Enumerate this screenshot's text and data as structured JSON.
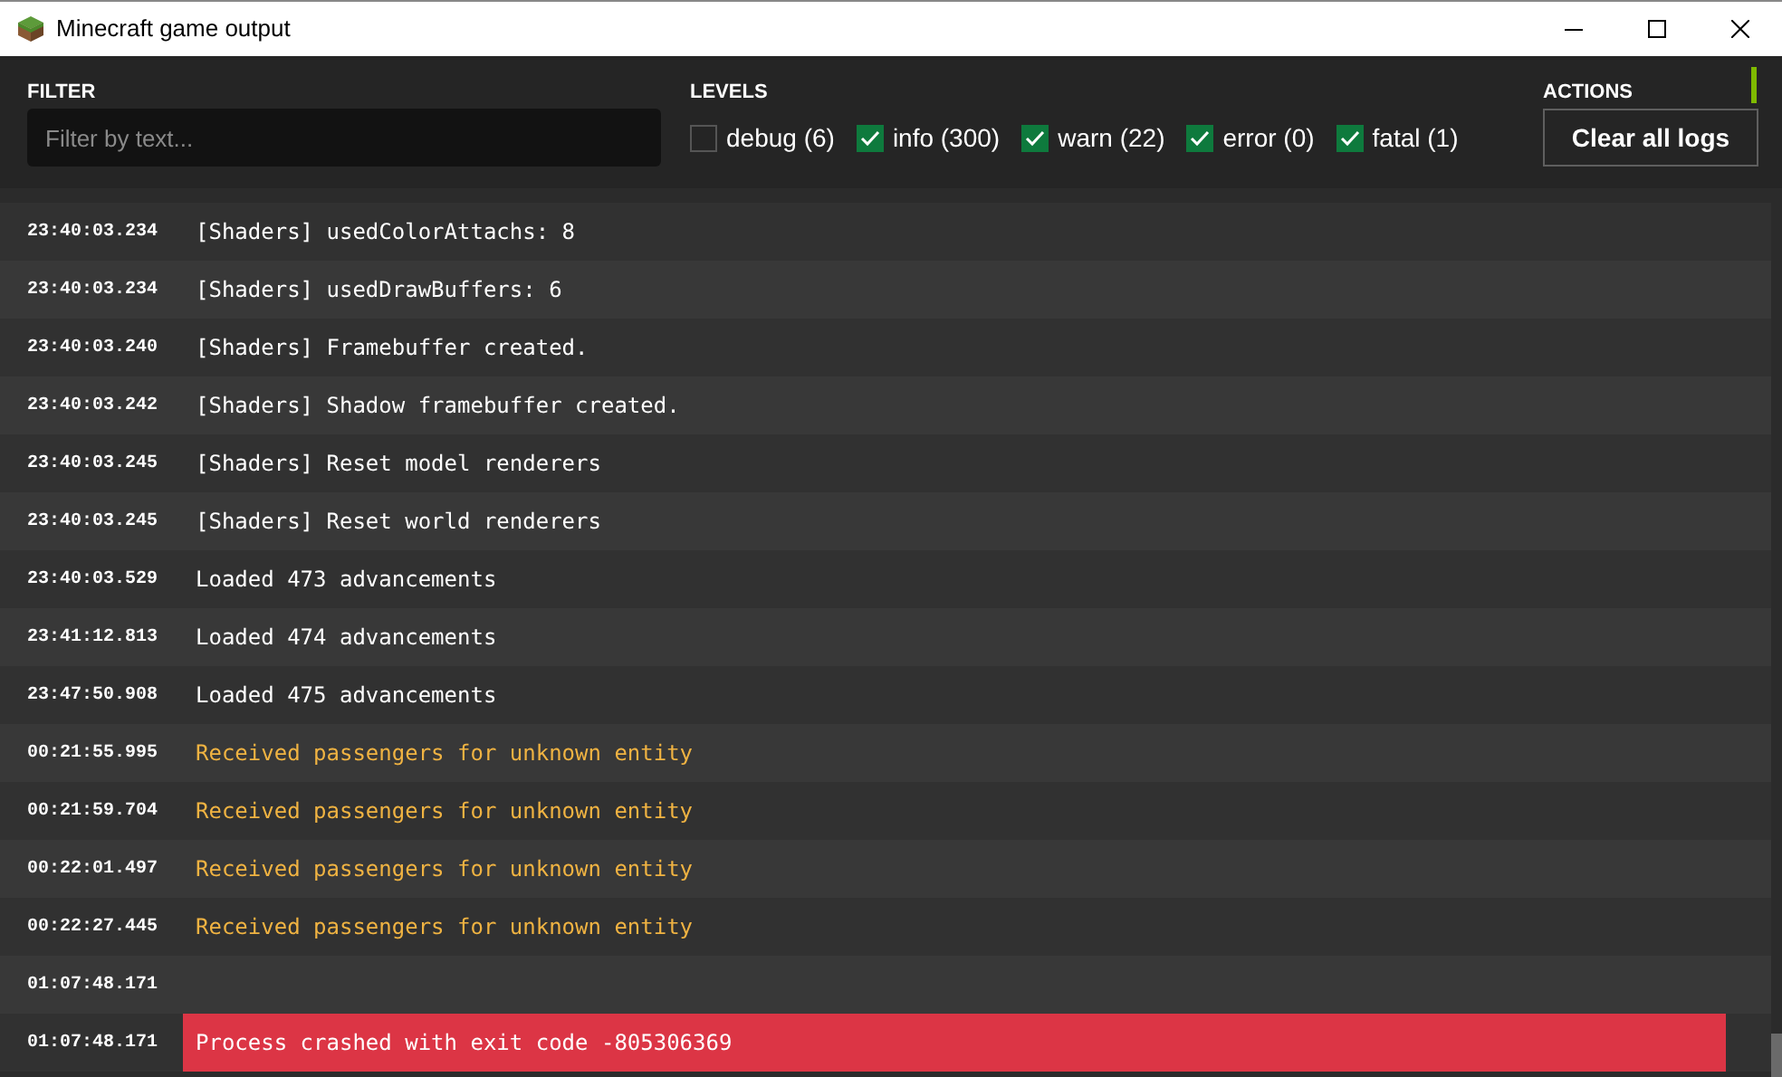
{
  "window": {
    "title": "Minecraft game output"
  },
  "filter": {
    "label": "FILTER",
    "placeholder": "Filter by text..."
  },
  "levels": {
    "label": "LEVELS",
    "items": [
      {
        "label": "debug (6)",
        "checked": false
      },
      {
        "label": "info (300)",
        "checked": true
      },
      {
        "label": "warn (22)",
        "checked": true
      },
      {
        "label": "error (0)",
        "checked": true
      },
      {
        "label": "fatal (1)",
        "checked": true
      }
    ]
  },
  "actions": {
    "label": "ACTIONS",
    "button": "Clear all logs"
  },
  "logs": [
    {
      "time": "23:40:03.234",
      "message": "[Shaders] usedColorAttachs: 8",
      "kind": "info"
    },
    {
      "time": "23:40:03.234",
      "message": "[Shaders] usedDrawBuffers: 6",
      "kind": "info"
    },
    {
      "time": "23:40:03.240",
      "message": "[Shaders] Framebuffer created.",
      "kind": "info"
    },
    {
      "time": "23:40:03.242",
      "message": "[Shaders] Shadow framebuffer created.",
      "kind": "info"
    },
    {
      "time": "23:40:03.245",
      "message": "[Shaders] Reset model renderers",
      "kind": "info"
    },
    {
      "time": "23:40:03.245",
      "message": "[Shaders] Reset world renderers",
      "kind": "info"
    },
    {
      "time": "23:40:03.529",
      "message": "Loaded 473 advancements",
      "kind": "info"
    },
    {
      "time": "23:41:12.813",
      "message": "Loaded 474 advancements",
      "kind": "info"
    },
    {
      "time": "23:47:50.908",
      "message": "Loaded 475 advancements",
      "kind": "info"
    },
    {
      "time": "00:21:55.995",
      "message": "Received passengers for unknown entity",
      "kind": "warn"
    },
    {
      "time": "00:21:59.704",
      "message": "Received passengers for unknown entity",
      "kind": "warn"
    },
    {
      "time": "00:22:01.497",
      "message": "Received passengers for unknown entity",
      "kind": "warn"
    },
    {
      "time": "00:22:27.445",
      "message": "Received passengers for unknown entity",
      "kind": "warn"
    },
    {
      "time": "01:07:48.171"
    },
    {
      "time": "01:07:48.171",
      "message": "Process crashed with exit code -805306369",
      "kind": "fatal"
    }
  ]
}
